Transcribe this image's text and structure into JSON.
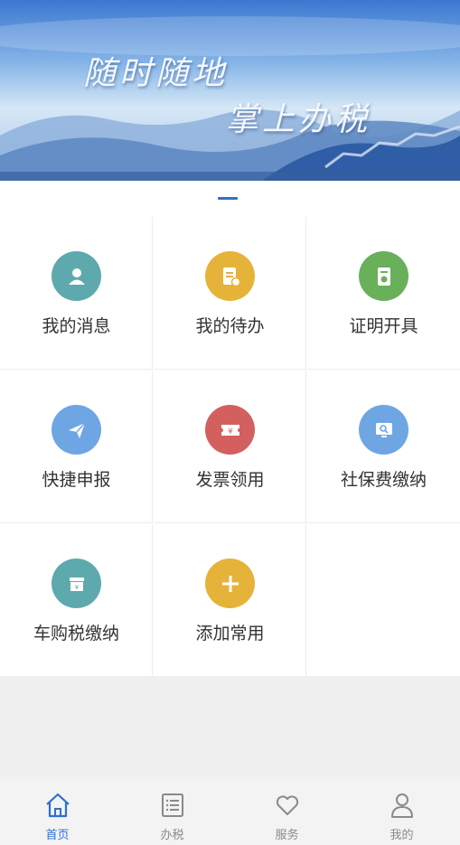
{
  "banner": {
    "line1": "随时随地",
    "line2": "掌上办税"
  },
  "colors": {
    "accent": "#2f6fcf",
    "teal": "#5ea9ad",
    "yellow": "#e6b33a",
    "green": "#69b05b",
    "blue": "#6ea6e4",
    "red": "#d45f5f"
  },
  "grid": {
    "items": [
      {
        "label": "我的消息",
        "icon": "user-icon",
        "color": "#5ea9ad"
      },
      {
        "label": "我的待办",
        "icon": "todo-list-icon",
        "color": "#e6b33a"
      },
      {
        "label": "证明开具",
        "icon": "certificate-icon",
        "color": "#69b05b"
      },
      {
        "label": "快捷申报",
        "icon": "paper-plane-icon",
        "color": "#6ea6e4"
      },
      {
        "label": "发票领用",
        "icon": "invoice-ticket-icon",
        "color": "#d45f5f"
      },
      {
        "label": "社保费缴纳",
        "icon": "monitor-search-icon",
        "color": "#6ea6e4"
      },
      {
        "label": "车购税缴纳",
        "icon": "tax-box-icon",
        "color": "#5ea9ad"
      },
      {
        "label": "添加常用",
        "icon": "plus-icon",
        "color": "#e6b33a"
      }
    ]
  },
  "tabbar": {
    "items": [
      {
        "label": "首页",
        "icon": "home-icon",
        "active": true
      },
      {
        "label": "办税",
        "icon": "list-icon",
        "active": false
      },
      {
        "label": "服务",
        "icon": "heart-icon",
        "active": false
      },
      {
        "label": "我的",
        "icon": "person-icon",
        "active": false
      }
    ]
  }
}
